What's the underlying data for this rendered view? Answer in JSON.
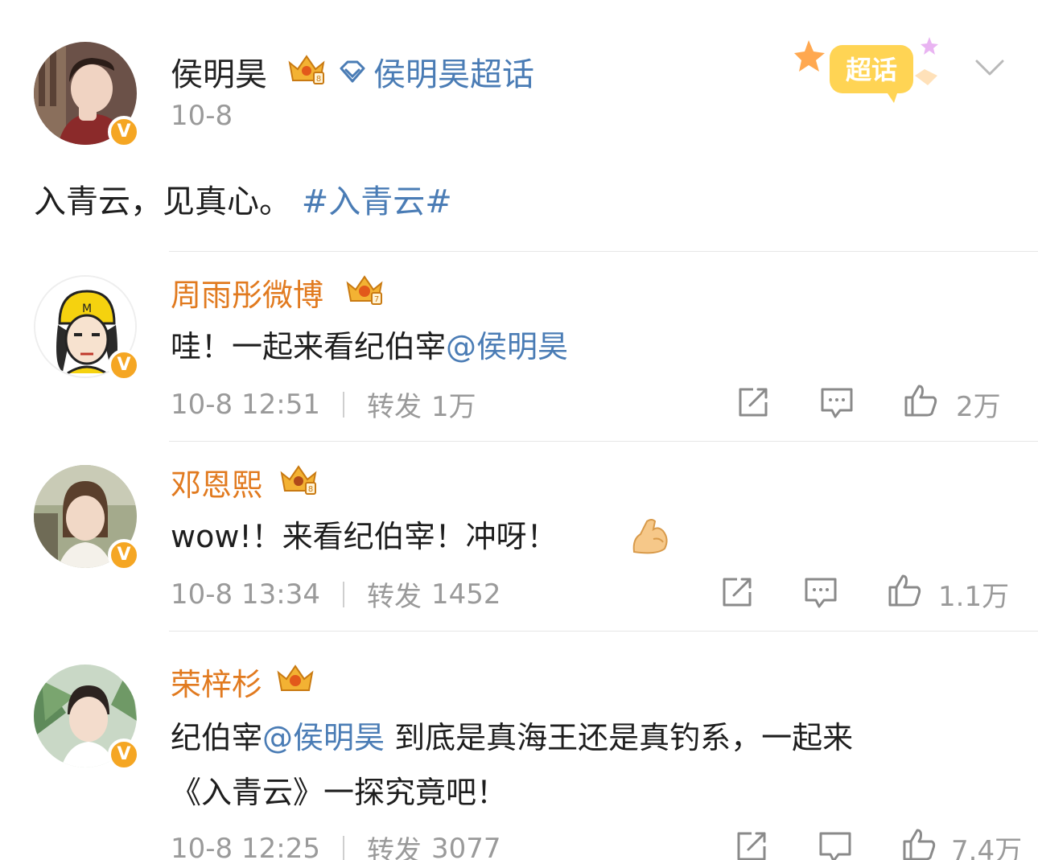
{
  "post": {
    "author": "侯明昊",
    "supertopic_label": "侯明昊超话",
    "time": "10-8",
    "text": "入青云，见真心。",
    "hashtag": "#入青云#",
    "badge_label": "超话"
  },
  "comments": [
    {
      "name": "周雨彤微博",
      "text_before": "哇！一起来看纪伯宰",
      "mention": "@侯明昊",
      "time": "10-8 12:51",
      "repost_label": "转发",
      "repost_count": "1万",
      "like_count": "2万"
    },
    {
      "name": "邓恩熙",
      "text_before": "wow!！来看纪伯宰！冲呀！",
      "emoji": "flexed-biceps-emoji",
      "time": "10-8 13:34",
      "repost_label": "转发",
      "repost_count": "1452",
      "like_count": "1.1万"
    },
    {
      "name": "荣梓杉",
      "line1_before": "纪伯宰",
      "mention": "@侯明昊",
      "line1_after": " 到底是真海王还是真钓系，一起来",
      "line2": "《入青云》一探究竟吧！",
      "time": "10-8 12:25",
      "repost_label": "转发",
      "repost_count": "3077",
      "like_count": "7.4万"
    }
  ],
  "icons": {
    "crown": "crown-icon",
    "verified": "verified-v-icon",
    "diamond": "diamond-icon",
    "chevron": "chevron-down-icon",
    "share": "share-icon",
    "comment": "comment-icon",
    "like": "thumbs-up-icon"
  },
  "colors": {
    "link_blue": "#4a7cb5",
    "comment_name_orange": "#e17a1f",
    "verified_orange": "#f5a623",
    "meta_gray": "#9a9a9a"
  }
}
